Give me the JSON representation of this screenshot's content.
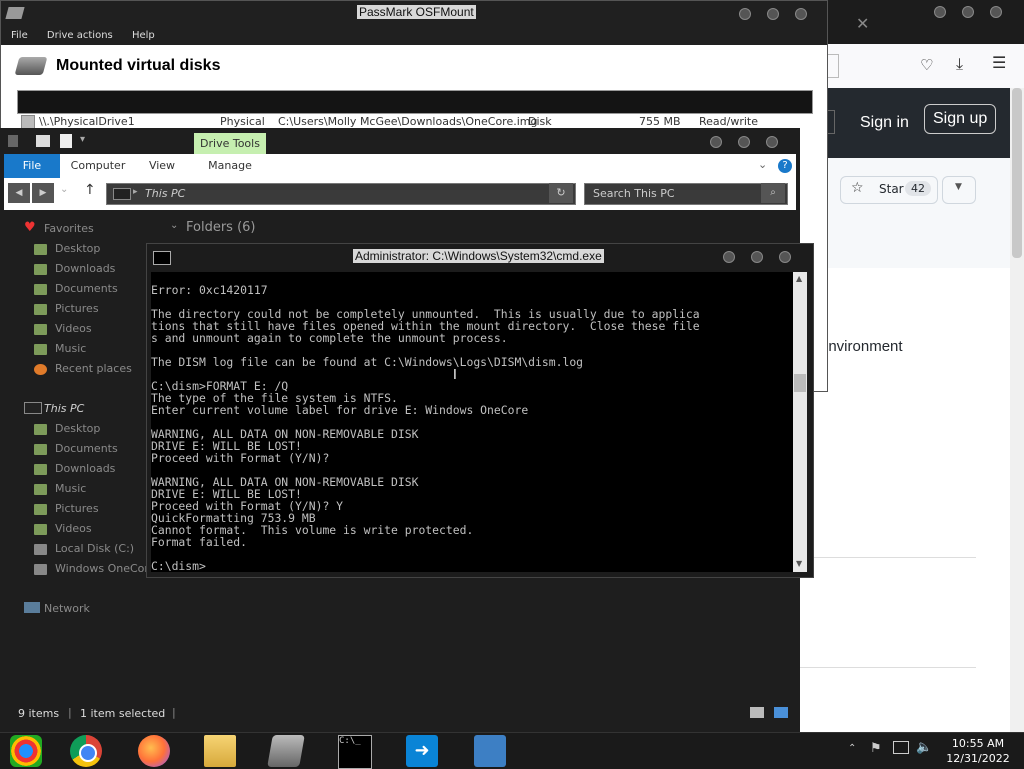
{
  "browser": {
    "sign_in": "Sign in",
    "sign_up": "Sign up",
    "star_label": "Star",
    "star_count": "42",
    "body_fragment": "environment"
  },
  "osfmount": {
    "title": "PassMark OSFMount",
    "menu": [
      "File",
      "Drive actions",
      "Help"
    ],
    "heading": "Mounted virtual disks",
    "row": {
      "source": "\\\\.\\PhysicalDrive1",
      "type": "Physical",
      "image": "C:\\Users\\Molly McGee\\Downloads\\OneCore.img",
      "kind": "Disk",
      "size": "755 MB",
      "mode": "Read/write"
    }
  },
  "explorer": {
    "drive_tools": "Drive Tools",
    "tabs": [
      "File",
      "Computer",
      "View",
      "Manage"
    ],
    "address": "This PC",
    "search_placeholder": "Search This PC",
    "folders_header": "Folders (6)",
    "favorites_label": "Favorites",
    "favorites": [
      "Desktop",
      "Downloads",
      "Documents",
      "Pictures",
      "Videos",
      "Music",
      "Recent places"
    ],
    "this_pc_label": "This PC",
    "this_pc_items": [
      "Desktop",
      "Documents",
      "Downloads",
      "Music",
      "Pictures",
      "Videos",
      "Local Disk (C:)",
      "Windows OneCore"
    ],
    "network_label": "Network",
    "status_items": "9 items",
    "status_selected": "1 item selected"
  },
  "cmd": {
    "title": "Administrator: C:\\Windows\\System32\\cmd.exe",
    "lines": [
      "",
      "Error: 0xc1420117",
      "",
      "The directory could not be completely unmounted.  This is usually due to applica",
      "tions that still have files opened within the mount directory.  Close these file",
      "s and unmount again to complete the unmount process.",
      "",
      "The DISM log file can be found at C:\\Windows\\Logs\\DISM\\dism.log",
      "",
      "C:\\dism>FORMAT E: /Q",
      "The type of the file system is NTFS.",
      "Enter current volume label for drive E: Windows OneCore",
      "",
      "WARNING, ALL DATA ON NON-REMOVABLE DISK",
      "DRIVE E: WILL BE LOST!",
      "Proceed with Format (Y/N)?",
      "",
      "WARNING, ALL DATA ON NON-REMOVABLE DISK",
      "DRIVE E: WILL BE LOST!",
      "Proceed with Format (Y/N)? Y",
      "QuickFormatting 753.9 MB",
      "Cannot format.  This volume is write protected.",
      "Format failed.",
      "",
      "C:\\dism>_"
    ]
  },
  "taskbar": {
    "time": "10:55 AM",
    "date": "12/31/2022"
  }
}
